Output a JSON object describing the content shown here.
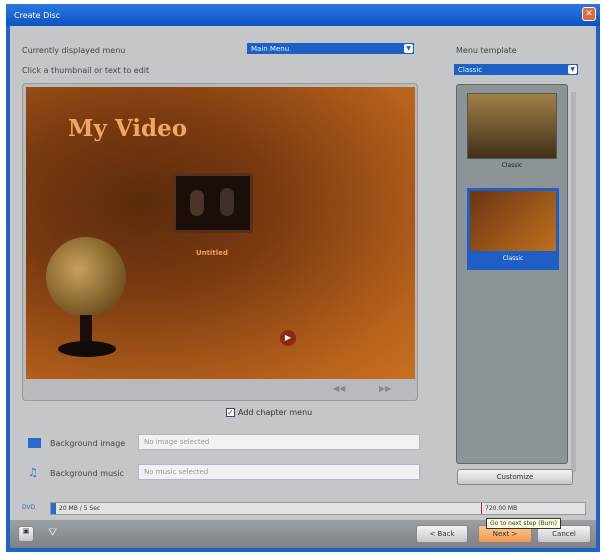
{
  "window": {
    "title": "Create Disc"
  },
  "menu_select": {
    "label": "Currently displayed menu",
    "value": "Main Menu"
  },
  "hint": "Click a thumbnail or text to edit",
  "preview": {
    "title": "My Video",
    "chapter_label": "Untitled"
  },
  "template": {
    "label": "Menu template",
    "value": "Classic",
    "items": [
      {
        "label": "Classic"
      },
      {
        "label": "Classic"
      }
    ],
    "selected_index": 1
  },
  "add_chapter_menu": {
    "label": "Add chapter menu",
    "checked": true
  },
  "background_image": {
    "label": "Background image",
    "placeholder": "No image selected"
  },
  "background_music": {
    "label": "Background music",
    "placeholder": "No music selected"
  },
  "customize_label": "Customize",
  "disc_usage": {
    "disc_type": "DVD",
    "used": "20 MB / 5 Sec",
    "capacity": "720.00 MB"
  },
  "buttons": {
    "back": "< Back",
    "next": "Next >",
    "cancel": "Cancel"
  },
  "tooltip": "Go to next step (Burn)",
  "colors": {
    "titlebar": "#1e64c8",
    "accent": "#1d5fc4",
    "next_button": "#f4a860"
  }
}
